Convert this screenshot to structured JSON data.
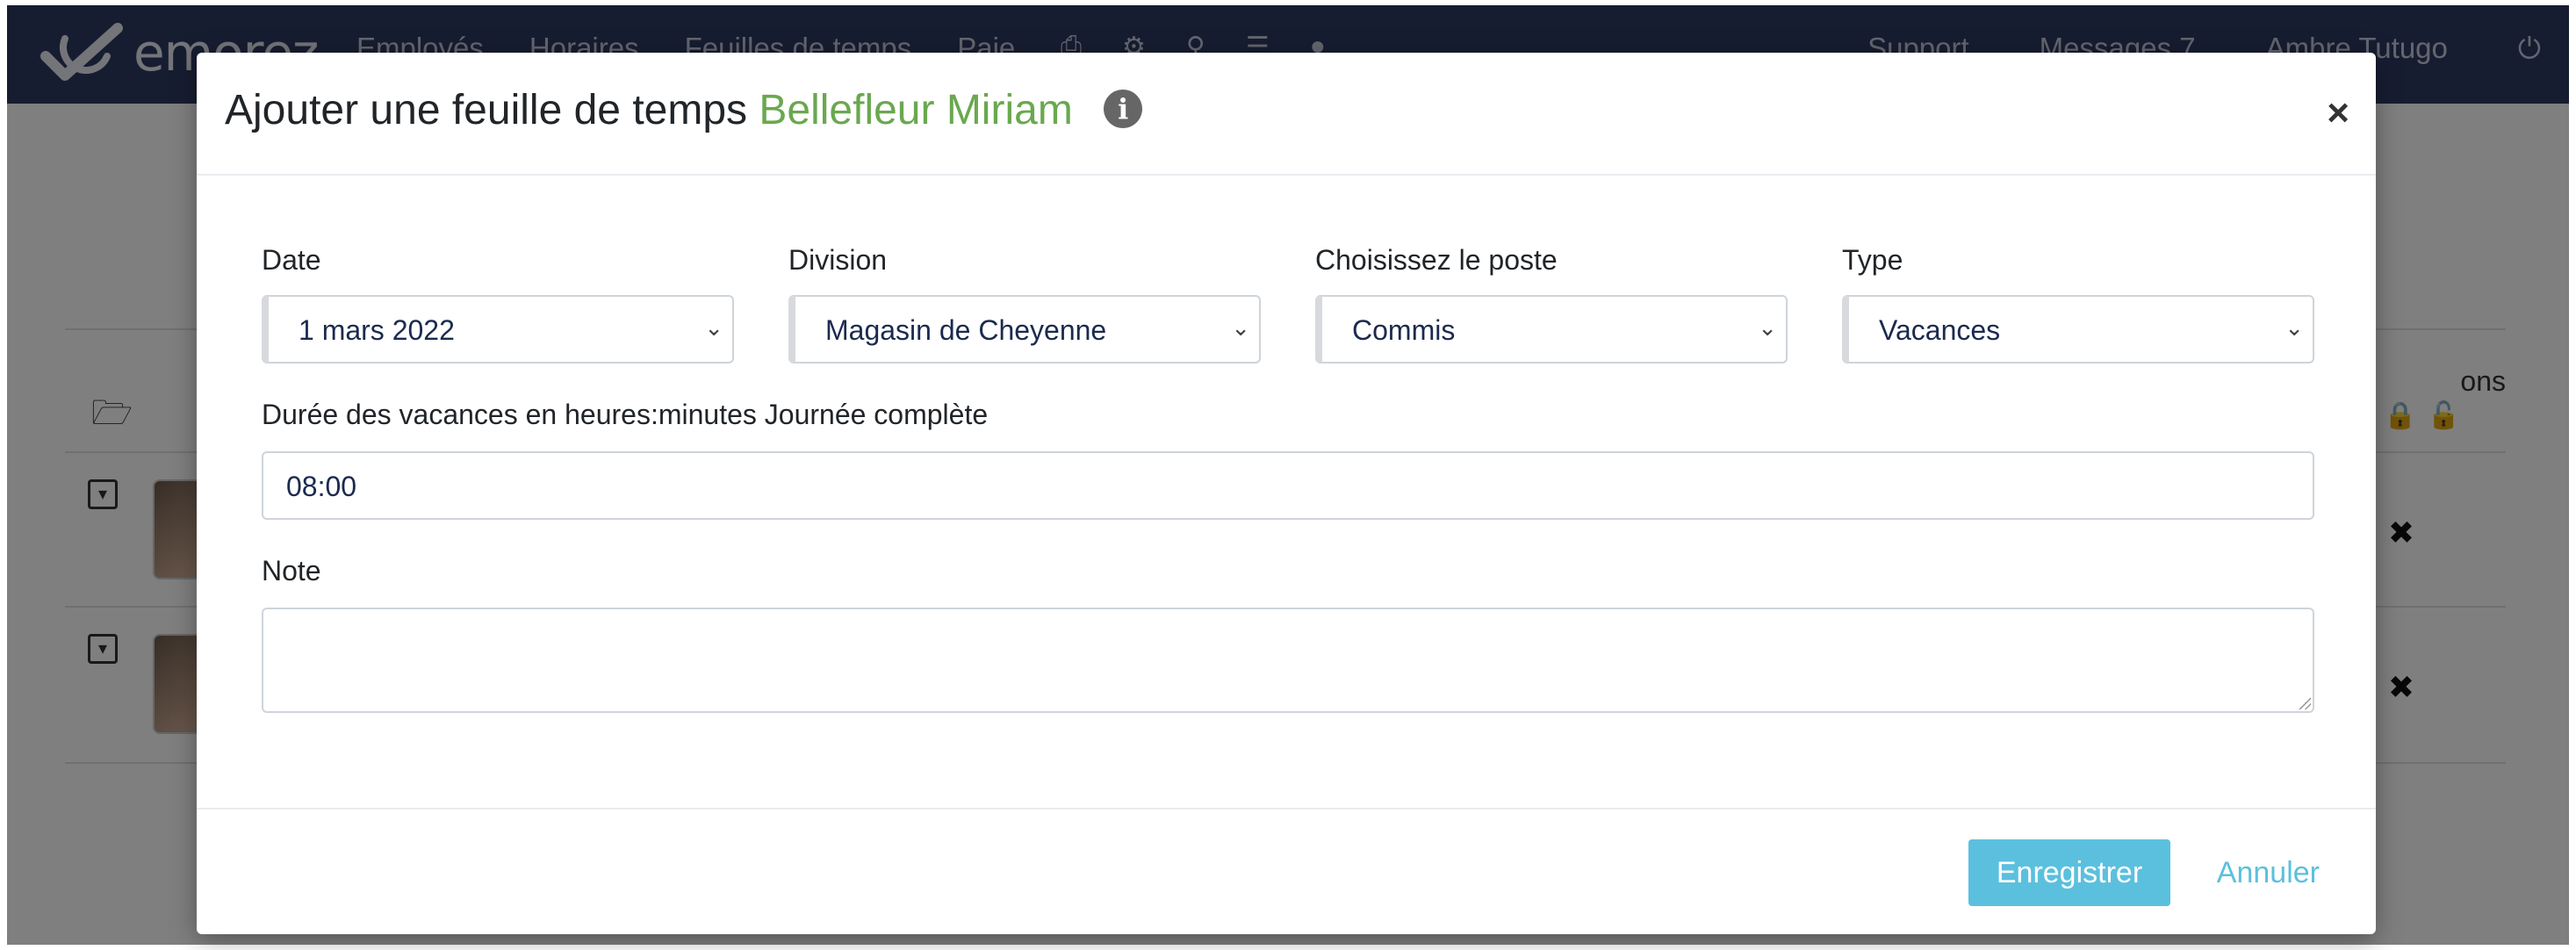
{
  "app": {
    "logo_text": "emorez",
    "nav": [
      "Employés",
      "Horaires",
      "Feuilles de temps",
      "Paie"
    ],
    "support": "Support",
    "messages": "Messages 7",
    "user": "Ambre Tutugo",
    "actions_head": "ons"
  },
  "modal": {
    "title_prefix": "Ajouter une feuille de temps",
    "employee": "Bellefleur Miriam",
    "info_icon": "i",
    "close": "×",
    "fields": {
      "date_label": "Date",
      "date_value": "1 mars 2022",
      "division_label": "Division",
      "division_value": "Magasin de Cheyenne",
      "poste_label": "Choisissez le poste",
      "poste_value": "Commis",
      "type_label": "Type",
      "type_value": "Vacances",
      "duration_label": "Durée des vacances en heures:minutes Journée complète",
      "duration_value": "08:00",
      "note_label": "Note",
      "note_value": ""
    },
    "buttons": {
      "save": "Enregistrer",
      "cancel": "Annuler"
    }
  }
}
